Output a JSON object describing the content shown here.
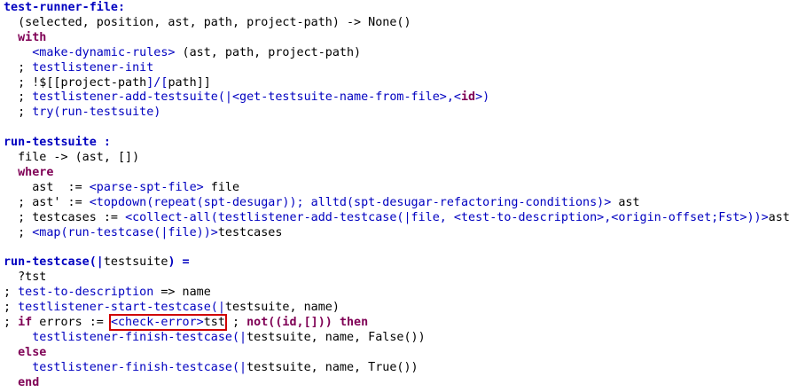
{
  "colors": {
    "background": "#ffffff",
    "definition_name": "#0000c0",
    "keyword": "#7f0055",
    "call": "#0000c0",
    "plain": "#000000",
    "highlight_box": "#d00000"
  },
  "lines": [
    {
      "tokens": [
        {
          "t": "test-runner-file",
          "c": "name"
        },
        {
          "t": ":",
          "c": "name"
        }
      ]
    },
    {
      "tokens": [
        {
          "t": "  (selected, position, ast, path, project-path) -> None()",
          "c": "plain"
        }
      ]
    },
    {
      "tokens": [
        {
          "t": "  ",
          "c": "plain"
        },
        {
          "t": "with",
          "c": "kw"
        }
      ]
    },
    {
      "tokens": [
        {
          "t": "    ",
          "c": "plain"
        },
        {
          "t": "<make-dynamic-rules>",
          "c": "call"
        },
        {
          "t": " (ast, path, project-path)",
          "c": "plain"
        }
      ]
    },
    {
      "tokens": [
        {
          "t": "  ; ",
          "c": "plain"
        },
        {
          "t": "testlistener-init",
          "c": "call"
        }
      ]
    },
    {
      "tokens": [
        {
          "t": "  ; !$[[",
          "c": "plain"
        },
        {
          "t": "project-path",
          "c": "plain"
        },
        {
          "t": "]/[",
          "c": "call"
        },
        {
          "t": "path",
          "c": "plain"
        },
        {
          "t": "]]",
          "c": "plain"
        }
      ]
    },
    {
      "tokens": [
        {
          "t": "  ; ",
          "c": "plain"
        },
        {
          "t": "testlistener-add-testsuite(|<get-testsuite-name-from-file>,<",
          "c": "call"
        },
        {
          "t": "id",
          "c": "kw"
        },
        {
          "t": ">)",
          "c": "call"
        }
      ]
    },
    {
      "tokens": [
        {
          "t": "  ; ",
          "c": "plain"
        },
        {
          "t": "try(run-testsuite)",
          "c": "call"
        }
      ]
    },
    {
      "tokens": []
    },
    {
      "tokens": [
        {
          "t": "run-testsuite :",
          "c": "name"
        }
      ]
    },
    {
      "tokens": [
        {
          "t": "  file -> (ast, [])",
          "c": "plain"
        }
      ]
    },
    {
      "tokens": [
        {
          "t": "  ",
          "c": "plain"
        },
        {
          "t": "where",
          "c": "kw"
        }
      ]
    },
    {
      "tokens": [
        {
          "t": "    ast  := ",
          "c": "plain"
        },
        {
          "t": "<parse-spt-file>",
          "c": "call"
        },
        {
          "t": " file",
          "c": "plain"
        }
      ]
    },
    {
      "tokens": [
        {
          "t": "  ; ast' := ",
          "c": "plain"
        },
        {
          "t": "<topdown(repeat(spt-desugar)); alltd(spt-desugar-refactoring-conditions)>",
          "c": "call"
        },
        {
          "t": " ast",
          "c": "plain"
        }
      ]
    },
    {
      "tokens": [
        {
          "t": "  ; testcases := ",
          "c": "plain"
        },
        {
          "t": "<collect-all(testlistener-add-testcase(|file, <test-to-description>,<origin-offset;Fst>))>",
          "c": "call"
        },
        {
          "t": "ast'",
          "c": "plain"
        }
      ]
    },
    {
      "tokens": [
        {
          "t": "  ; ",
          "c": "plain"
        },
        {
          "t": "<map(run-testcase(|file))>",
          "c": "call"
        },
        {
          "t": "testcases",
          "c": "plain"
        }
      ]
    },
    {
      "tokens": []
    },
    {
      "tokens": [
        {
          "t": "run-testcase(|",
          "c": "name"
        },
        {
          "t": "testsuite",
          "c": "plain"
        },
        {
          "t": ") =",
          "c": "name"
        }
      ]
    },
    {
      "tokens": [
        {
          "t": "  ?tst",
          "c": "plain"
        }
      ]
    },
    {
      "tokens": [
        {
          "t": "; ",
          "c": "plain"
        },
        {
          "t": "test-to-description",
          "c": "call"
        },
        {
          "t": " => name",
          "c": "plain"
        }
      ]
    },
    {
      "tokens": [
        {
          "t": "; ",
          "c": "plain"
        },
        {
          "t": "testlistener-start-testcase(|",
          "c": "call"
        },
        {
          "t": "testsuite, name)",
          "c": "plain"
        }
      ]
    },
    {
      "tokens": [
        {
          "t": "; ",
          "c": "plain"
        },
        {
          "t": "if",
          "c": "kw"
        },
        {
          "t": " errors := ",
          "c": "plain"
        },
        {
          "t": "<check-error>",
          "c": "call",
          "boxed": true
        },
        {
          "t": "tst",
          "c": "plain",
          "boxed": true
        },
        {
          "t": " ; ",
          "c": "plain"
        },
        {
          "t": "not((id,[]))",
          "c": "kw"
        },
        {
          "t": " ",
          "c": "plain"
        },
        {
          "t": "then",
          "c": "kw"
        }
      ]
    },
    {
      "tokens": [
        {
          "t": "    ",
          "c": "plain"
        },
        {
          "t": "testlistener-finish-testcase(|",
          "c": "call"
        },
        {
          "t": "testsuite, name, False())",
          "c": "plain"
        }
      ]
    },
    {
      "tokens": [
        {
          "t": "  ",
          "c": "plain"
        },
        {
          "t": "else",
          "c": "kw"
        }
      ]
    },
    {
      "tokens": [
        {
          "t": "    ",
          "c": "plain"
        },
        {
          "t": "testlistener-finish-testcase(|",
          "c": "call"
        },
        {
          "t": "testsuite, name, True())",
          "c": "plain"
        }
      ]
    },
    {
      "tokens": [
        {
          "t": "  ",
          "c": "plain"
        },
        {
          "t": "end",
          "c": "kw"
        }
      ]
    }
  ]
}
